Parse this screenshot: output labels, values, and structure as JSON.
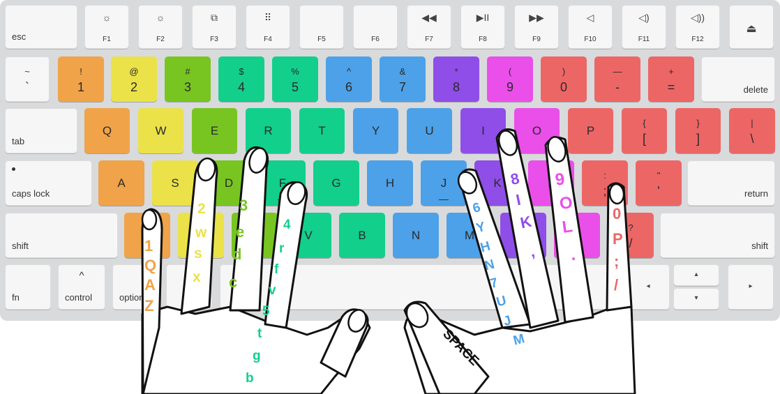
{
  "colors": {
    "orange": "#f0a348",
    "yellow": "#ebe24a",
    "lime": "#78c522",
    "green": "#12cf8c",
    "blue": "#4ca1e8",
    "purple": "#8f4ee8",
    "magenta": "#ea4fe9",
    "red": "#ec6666",
    "plain": "#f6f6f6"
  },
  "keyboard": {
    "function_row": [
      {
        "label": "esc",
        "icon": ""
      },
      {
        "label": "F1",
        "icon": "☼"
      },
      {
        "label": "F2",
        "icon": "☼"
      },
      {
        "label": "F3",
        "icon": "⧉"
      },
      {
        "label": "F4",
        "icon": "⠿"
      },
      {
        "label": "F5",
        "icon": ""
      },
      {
        "label": "F6",
        "icon": ""
      },
      {
        "label": "F7",
        "icon": "◀◀"
      },
      {
        "label": "F8",
        "icon": "▶II"
      },
      {
        "label": "F9",
        "icon": "▶▶"
      },
      {
        "label": "F10",
        "icon": "◁"
      },
      {
        "label": "F11",
        "icon": "◁)"
      },
      {
        "label": "F12",
        "icon": "◁))"
      },
      {
        "label": "",
        "icon": "⏏"
      }
    ],
    "number_row": [
      {
        "upper": "~",
        "lower": "`",
        "color": "plain"
      },
      {
        "upper": "!",
        "lower": "1",
        "color": "orange"
      },
      {
        "upper": "@",
        "lower": "2",
        "color": "yellow"
      },
      {
        "upper": "#",
        "lower": "3",
        "color": "lime"
      },
      {
        "upper": "$",
        "lower": "4",
        "color": "green"
      },
      {
        "upper": "%",
        "lower": "5",
        "color": "green"
      },
      {
        "upper": "^",
        "lower": "6",
        "color": "blue"
      },
      {
        "upper": "&",
        "lower": "7",
        "color": "blue"
      },
      {
        "upper": "*",
        "lower": "8",
        "color": "purple"
      },
      {
        "upper": "(",
        "lower": "9",
        "color": "magenta"
      },
      {
        "upper": ")",
        "lower": "0",
        "color": "red"
      },
      {
        "upper": "—",
        "lower": "-",
        "color": "red"
      },
      {
        "upper": "+",
        "lower": "=",
        "color": "red"
      },
      {
        "word": "delete",
        "color": "plain"
      }
    ],
    "top_row": [
      {
        "word": "tab",
        "color": "plain"
      },
      {
        "label": "Q",
        "color": "orange"
      },
      {
        "label": "W",
        "color": "yellow"
      },
      {
        "label": "E",
        "color": "lime"
      },
      {
        "label": "R",
        "color": "green"
      },
      {
        "label": "T",
        "color": "green"
      },
      {
        "label": "Y",
        "color": "blue"
      },
      {
        "label": "U",
        "color": "blue"
      },
      {
        "label": "I",
        "color": "purple"
      },
      {
        "label": "O",
        "color": "magenta"
      },
      {
        "label": "P",
        "color": "red"
      },
      {
        "upper": "{",
        "lower": "[",
        "color": "red"
      },
      {
        "upper": "}",
        "lower": "]",
        "color": "red"
      },
      {
        "upper": "|",
        "lower": "\\",
        "color": "red"
      }
    ],
    "home_row": [
      {
        "word": "caps lock",
        "color": "plain"
      },
      {
        "label": "A",
        "color": "orange"
      },
      {
        "label": "S",
        "color": "yellow"
      },
      {
        "label": "D",
        "color": "lime"
      },
      {
        "label": "F",
        "color": "green"
      },
      {
        "label": "G",
        "color": "green"
      },
      {
        "label": "H",
        "color": "blue"
      },
      {
        "label": "J",
        "color": "blue"
      },
      {
        "label": "K",
        "color": "purple"
      },
      {
        "label": "L",
        "color": "magenta"
      },
      {
        "upper": ":",
        "lower": ";",
        "color": "red"
      },
      {
        "upper": "\"",
        "lower": "'",
        "color": "red"
      },
      {
        "word": "return",
        "color": "plain"
      }
    ],
    "bottom_row": [
      {
        "word": "shift",
        "color": "plain"
      },
      {
        "label": "Z",
        "color": "orange"
      },
      {
        "label": "X",
        "color": "yellow"
      },
      {
        "label": "C",
        "color": "lime"
      },
      {
        "label": "V",
        "color": "green"
      },
      {
        "label": "B",
        "color": "green"
      },
      {
        "label": "N",
        "color": "blue"
      },
      {
        "label": "M",
        "color": "blue"
      },
      {
        "label": "<",
        "color": "purple"
      },
      {
        "label": ">",
        "color": "magenta"
      },
      {
        "upper": "?",
        "lower": "/",
        "color": "red"
      },
      {
        "word": "shift",
        "color": "plain"
      }
    ],
    "modifier_row": [
      {
        "word": "fn"
      },
      {
        "word": "control",
        "top": "^"
      },
      {
        "word": "option"
      },
      {
        "word": ""
      },
      {
        "word": ""
      },
      {
        "word": ""
      },
      {
        "word": ""
      },
      {
        "word": ""
      },
      {
        "word": "◂"
      },
      {
        "word": "▴"
      },
      {
        "word": "▾"
      },
      {
        "word": "▸"
      }
    ]
  },
  "finger_labels": {
    "left_pinky": [
      "1",
      "Q",
      "A",
      "Z"
    ],
    "left_ring": [
      "2",
      "w",
      "s",
      "x"
    ],
    "left_middle": [
      "3",
      "e",
      "d",
      "c"
    ],
    "left_index": [
      "4",
      "r",
      "f",
      "v",
      "5",
      "t",
      "g",
      "b"
    ],
    "right_index": [
      "6",
      "Y",
      "H",
      "N",
      "7",
      "U",
      "J",
      "M"
    ],
    "right_middle": [
      "8",
      "I",
      "K",
      ","
    ],
    "right_ring": [
      "9",
      "O",
      "L",
      "."
    ],
    "right_pinky": [
      "0",
      "P",
      ";",
      "/"
    ],
    "thumb": "SPACE"
  }
}
